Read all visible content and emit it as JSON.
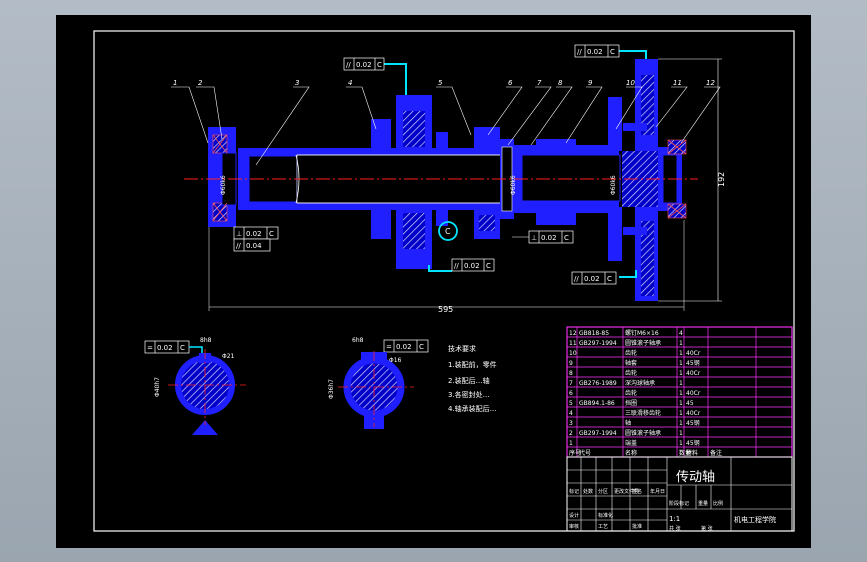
{
  "colors": {
    "background": "#000000",
    "frame": "#ffffff",
    "part": "#1f1fff",
    "hatch": "#c8c8ff",
    "centerline": "#ff2020",
    "dimension": "#ffffff",
    "leader": "#00e5ff",
    "table": "#ff33ff",
    "text": "#ffffff"
  },
  "balloons": [
    "1",
    "2",
    "3",
    "4",
    "5",
    "6",
    "7",
    "8",
    "9",
    "10",
    "11",
    "12"
  ],
  "tolerances": {
    "top_gear": [
      "//",
      "0.02",
      "C"
    ],
    "top_right": [
      "//",
      "0.02",
      "C"
    ],
    "left_1": [
      "⊥",
      "0.02",
      "C"
    ],
    "left_2": [
      "//",
      "0.04",
      ""
    ],
    "bottom_mid": [
      "//",
      "0.02",
      "C"
    ],
    "right_mid": [
      "⊥",
      "0.02",
      "C"
    ],
    "bottom_right": [
      "//",
      "0.02",
      "C"
    ],
    "section_left": [
      "=",
      "0.02",
      "C"
    ],
    "section_right": [
      "=",
      "0.02",
      "C"
    ]
  },
  "datum_label": "C",
  "dimensions": {
    "overall_length": "595",
    "height_right": "192",
    "dia_left": "Φ60k6",
    "dia_mid": "Φ60k6",
    "dia_right": "Φ60k6",
    "sec1_key": "8h8",
    "sec1_dia": "Φ21",
    "sec1_dia2": "Φ40h7",
    "sec2_key": "6h8",
    "sec2_dia": "Φ16",
    "sec2_dia2": "Φ36h7"
  },
  "notes": {
    "heading": "技术要求",
    "lines": [
      "1.装配前，零件",
      "2.装配后…轴",
      "3.各密封处…",
      "4.轴承装配后…"
    ]
  },
  "bom": {
    "rows": [
      {
        "no": "12",
        "code": "GB818-85",
        "name": "螺钉M6×16",
        "qty": "4",
        "material": "",
        "note": ""
      },
      {
        "no": "11",
        "code": "GB297-1994",
        "name": "圆锥滚子轴承",
        "qty": "1",
        "material": "",
        "note": ""
      },
      {
        "no": "10",
        "code": "",
        "name": "齿轮",
        "qty": "1",
        "material": "40Cr",
        "note": ""
      },
      {
        "no": "9",
        "code": "",
        "name": "轴套",
        "qty": "1",
        "material": "45钢",
        "note": ""
      },
      {
        "no": "8",
        "code": "",
        "name": "齿轮",
        "qty": "1",
        "material": "40Cr",
        "note": ""
      },
      {
        "no": "7",
        "code": "GB276-1989",
        "name": "深沟球轴承",
        "qty": "1",
        "material": "",
        "note": ""
      },
      {
        "no": "6",
        "code": "",
        "name": "齿轮",
        "qty": "1",
        "material": "40Cr",
        "note": ""
      },
      {
        "no": "5",
        "code": "GB894.1-86",
        "name": "挡圈",
        "qty": "1",
        "material": "45",
        "note": ""
      },
      {
        "no": "4",
        "code": "",
        "name": "三联滑移齿轮",
        "qty": "1",
        "material": "40Cr",
        "note": ""
      },
      {
        "no": "3",
        "code": "",
        "name": "轴",
        "qty": "1",
        "material": "45钢",
        "note": ""
      },
      {
        "no": "2",
        "code": "GB297-1994",
        "name": "圆锥滚子轴承",
        "qty": "1",
        "material": "",
        "note": ""
      },
      {
        "no": "1",
        "code": "",
        "name": "端盖",
        "qty": "1",
        "material": "45钢",
        "note": ""
      }
    ],
    "header": {
      "no": "序号",
      "code": "代号",
      "name": "名称",
      "qty": "数量",
      "material": "材料",
      "note": "备注"
    }
  },
  "title_block": {
    "title": "传动轴",
    "scale": "1:1",
    "school": "机电工程学院",
    "cells": [
      "标记",
      "处数",
      "分区",
      "更改文件号",
      "签名",
      "年月日",
      "设计",
      "标准化",
      "审核",
      "工艺",
      "批准",
      "阶段标记",
      "重量",
      "比例",
      "共 张",
      "第 张"
    ]
  }
}
